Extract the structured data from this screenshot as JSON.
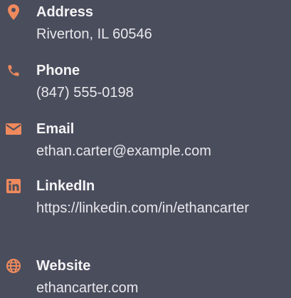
{
  "colors": {
    "background": "#4a4d5c",
    "accent": "#f08a5d",
    "text": "#f1f1f4"
  },
  "contacts": [
    {
      "icon": "map-pin-icon",
      "label": "Address",
      "value": "Riverton, IL 60546"
    },
    {
      "icon": "phone-icon",
      "label": "Phone",
      "value": "(847) 555-0198"
    },
    {
      "icon": "envelope-icon",
      "label": "Email",
      "value": "ethan.carter@example.com"
    },
    {
      "icon": "linkedin-icon",
      "label": "LinkedIn",
      "value": "https://linkedin.com/in/ethancarter"
    },
    {
      "icon": "globe-icon",
      "label": "Website",
      "value": "ethancarter.com"
    }
  ]
}
